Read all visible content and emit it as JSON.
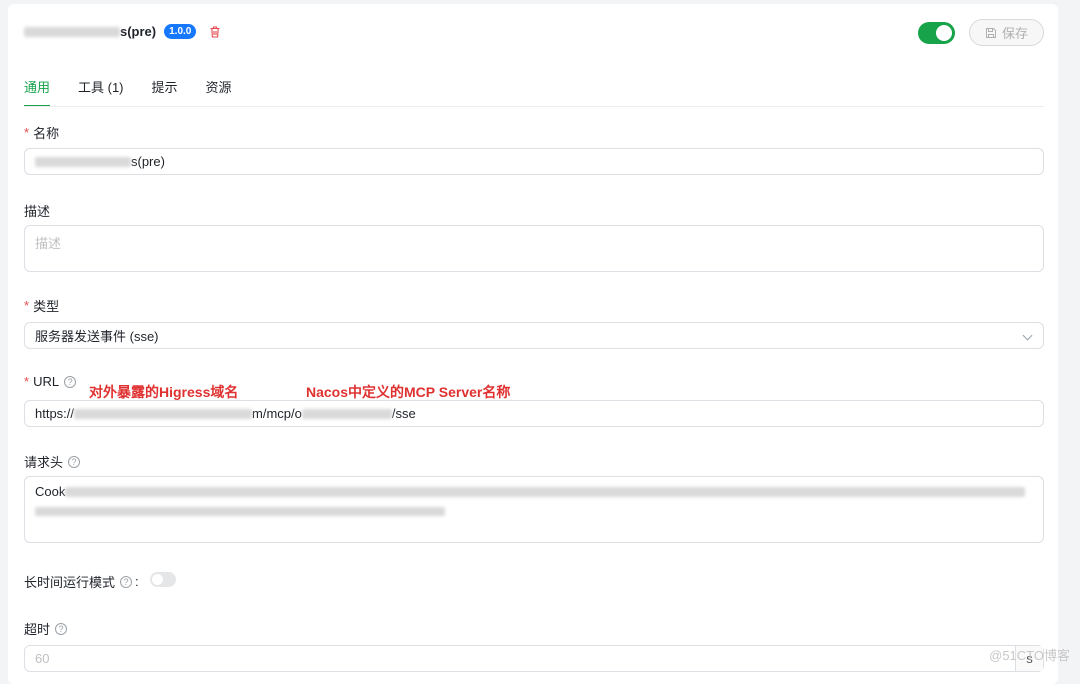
{
  "header": {
    "name_suffix": "s(pre)",
    "version": "1.0.0",
    "save_label": "保存",
    "enabled": true
  },
  "tabs": [
    {
      "label": "通用",
      "active": true
    },
    {
      "label": "工具 (1)",
      "active": false
    },
    {
      "label": "提示",
      "active": false
    },
    {
      "label": "资源",
      "active": false
    }
  ],
  "form": {
    "name_label": "名称",
    "name_value_suffix": "s(pre)",
    "desc_label": "描述",
    "desc_placeholder": "描述",
    "type_label": "类型",
    "type_value": "服务器发送事件 (sse)",
    "url_label": "URL",
    "url_prefix": "https://",
    "url_mid": "m/mcp/o",
    "url_suffix": "/sse",
    "headers_label": "请求头",
    "headers_value_prefix": "Cook",
    "long_running_label": "长时间运行模式",
    "long_running_colon": ":",
    "timeout_label": "超时",
    "timeout_placeholder": "60",
    "timeout_unit": "s"
  },
  "annotations": {
    "domain_note": "对外暴露的Higress域名",
    "server_note": "Nacos中定义的MCP Server名称"
  },
  "watermark": "@51CTO博客",
  "colors": {
    "accent": "#16a34a",
    "badge": "#1677ff",
    "annotation": "#e03131",
    "required": "#e5484d"
  }
}
